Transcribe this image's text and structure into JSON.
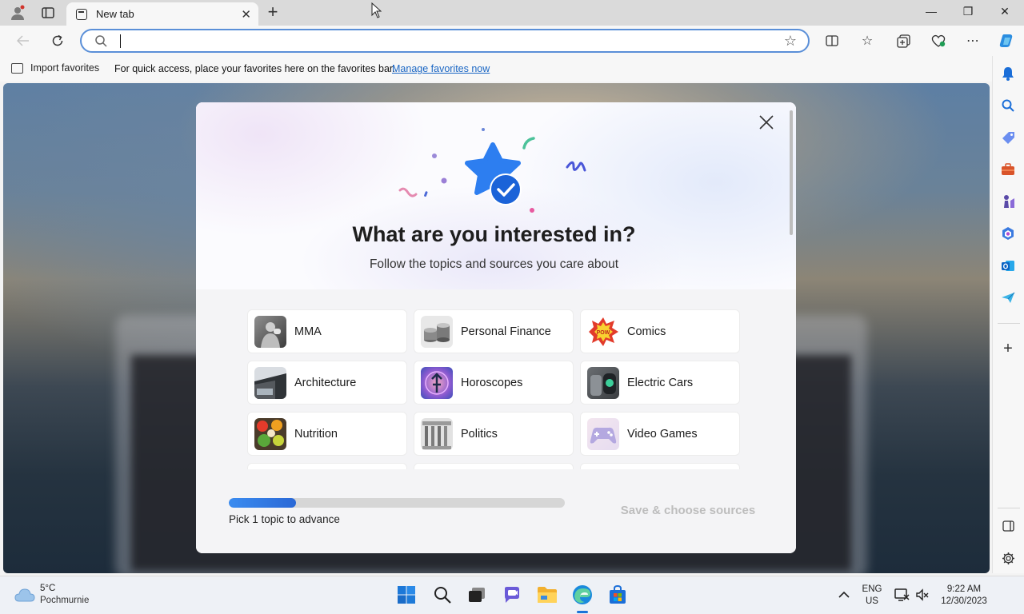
{
  "browser": {
    "tab_title": "New tab",
    "address_value": "",
    "favorites_bar": {
      "import_label": "Import favorites",
      "message": "For quick access, place your favorites here on the favorites bar.",
      "manage_link": "Manage favorites now"
    }
  },
  "modal": {
    "title": "What are you interested in?",
    "subtitle": "Follow the topics and sources you care about",
    "topics": [
      {
        "label": "MMA",
        "icon": "mma-thumb"
      },
      {
        "label": "Personal Finance",
        "icon": "finance-thumb"
      },
      {
        "label": "Comics",
        "icon": "comics-thumb"
      },
      {
        "label": "Architecture",
        "icon": "architecture-thumb"
      },
      {
        "label": "Horoscopes",
        "icon": "horoscopes-thumb"
      },
      {
        "label": "Electric Cars",
        "icon": "electric-cars-thumb"
      },
      {
        "label": "Nutrition",
        "icon": "nutrition-thumb"
      },
      {
        "label": "Politics",
        "icon": "politics-thumb"
      },
      {
        "label": "Video Games",
        "icon": "video-games-thumb"
      }
    ],
    "progress_fraction": 0.2,
    "hint": "Pick 1 topic to advance",
    "save_label": "Save & choose sources"
  },
  "taskbar": {
    "weather_temp": "5°C",
    "weather_condition": "Pochmurnie",
    "lang_top": "ENG",
    "lang_bottom": "US",
    "time": "9:22 AM",
    "date": "12/30/2023"
  },
  "colors": {
    "accent": "#2a68d6",
    "link": "#1a66c4",
    "disabled_text": "#bdbdbd"
  }
}
